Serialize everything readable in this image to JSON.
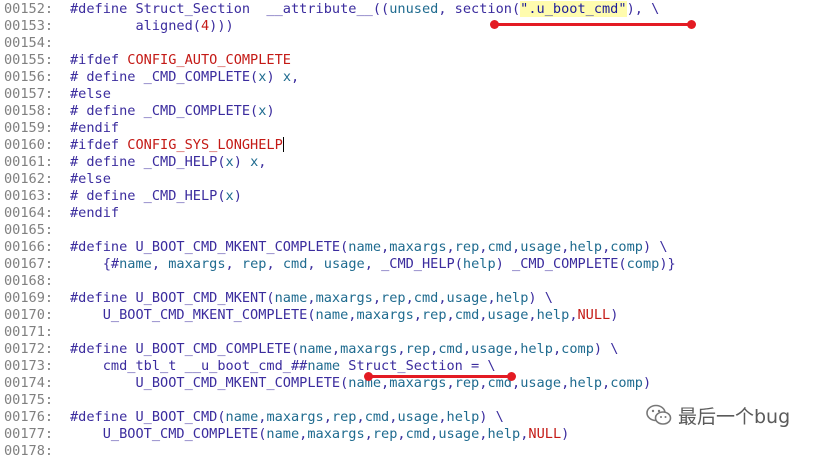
{
  "colors": {
    "line_number": "#808080",
    "keyword": "#3b2c9e",
    "macro": "#c41a16",
    "param": "#1f6b8f",
    "string_highlight": "#fffcae",
    "annotation": "#e31b23"
  },
  "code_lines": [
    {
      "num": "00152:",
      "tokens": [
        {
          "t": "#define",
          "c": "directive"
        },
        {
          "t": " Struct_Section  __attribute__((",
          "c": "ident"
        },
        {
          "t": "unused",
          "c": "param"
        },
        {
          "t": ", section(",
          "c": "ident"
        },
        {
          "t": "\".u_boot_cmd\"",
          "c": "string"
        },
        {
          "t": "), \\",
          "c": "ident"
        }
      ]
    },
    {
      "num": "00153:",
      "tokens": [
        {
          "t": "        aligned(",
          "c": "ident"
        },
        {
          "t": "4",
          "c": "number"
        },
        {
          "t": ")))",
          "c": "ident"
        }
      ]
    },
    {
      "num": "00154:",
      "tokens": []
    },
    {
      "num": "00155:",
      "tokens": [
        {
          "t": "#ifdef",
          "c": "directive"
        },
        {
          "t": " ",
          "c": "ident"
        },
        {
          "t": "CONFIG_AUTO_COMPLETE",
          "c": "macro"
        }
      ]
    },
    {
      "num": "00156:",
      "tokens": [
        {
          "t": "# define _CMD_COMPLETE(",
          "c": "ident"
        },
        {
          "t": "x",
          "c": "param"
        },
        {
          "t": ") ",
          "c": "ident"
        },
        {
          "t": "x",
          "c": "param"
        },
        {
          "t": ",",
          "c": "ident"
        }
      ]
    },
    {
      "num": "00157:",
      "tokens": [
        {
          "t": "#else",
          "c": "directive"
        }
      ]
    },
    {
      "num": "00158:",
      "tokens": [
        {
          "t": "# define _CMD_COMPLETE(",
          "c": "ident"
        },
        {
          "t": "x",
          "c": "param"
        },
        {
          "t": ")",
          "c": "ident"
        }
      ]
    },
    {
      "num": "00159:",
      "tokens": [
        {
          "t": "#endif",
          "c": "directive"
        }
      ]
    },
    {
      "num": "00160:",
      "tokens": [
        {
          "t": "#ifdef",
          "c": "directive"
        },
        {
          "t": " ",
          "c": "ident"
        },
        {
          "t": "CONFIG_SYS_LONGHELP",
          "c": "macro"
        }
      ],
      "cursor": true
    },
    {
      "num": "00161:",
      "tokens": [
        {
          "t": "# define _CMD_HELP(",
          "c": "ident"
        },
        {
          "t": "x",
          "c": "param"
        },
        {
          "t": ") ",
          "c": "ident"
        },
        {
          "t": "x",
          "c": "param"
        },
        {
          "t": ",",
          "c": "ident"
        }
      ]
    },
    {
      "num": "00162:",
      "tokens": [
        {
          "t": "#else",
          "c": "directive"
        }
      ]
    },
    {
      "num": "00163:",
      "tokens": [
        {
          "t": "# define _CMD_HELP(",
          "c": "ident"
        },
        {
          "t": "x",
          "c": "param"
        },
        {
          "t": ")",
          "c": "ident"
        }
      ]
    },
    {
      "num": "00164:",
      "tokens": [
        {
          "t": "#endif",
          "c": "directive"
        }
      ]
    },
    {
      "num": "00165:",
      "tokens": []
    },
    {
      "num": "00166:",
      "tokens": [
        {
          "t": "#define",
          "c": "directive"
        },
        {
          "t": " U_BOOT_CMD_MKENT_COMPLETE(",
          "c": "ident"
        },
        {
          "t": "name",
          "c": "param"
        },
        {
          "t": ",",
          "c": "ident"
        },
        {
          "t": "maxargs",
          "c": "param"
        },
        {
          "t": ",",
          "c": "ident"
        },
        {
          "t": "rep",
          "c": "param"
        },
        {
          "t": ",",
          "c": "ident"
        },
        {
          "t": "cmd",
          "c": "param"
        },
        {
          "t": ",",
          "c": "ident"
        },
        {
          "t": "usage",
          "c": "param"
        },
        {
          "t": ",",
          "c": "ident"
        },
        {
          "t": "help",
          "c": "param"
        },
        {
          "t": ",",
          "c": "ident"
        },
        {
          "t": "comp",
          "c": "param"
        },
        {
          "t": ") \\",
          "c": "ident"
        }
      ]
    },
    {
      "num": "00167:",
      "tokens": [
        {
          "t": "    {#",
          "c": "ident"
        },
        {
          "t": "name",
          "c": "param"
        },
        {
          "t": ", ",
          "c": "ident"
        },
        {
          "t": "maxargs",
          "c": "param"
        },
        {
          "t": ", ",
          "c": "ident"
        },
        {
          "t": "rep",
          "c": "param"
        },
        {
          "t": ", ",
          "c": "ident"
        },
        {
          "t": "cmd",
          "c": "param"
        },
        {
          "t": ", ",
          "c": "ident"
        },
        {
          "t": "usage",
          "c": "param"
        },
        {
          "t": ", _CMD_HELP(",
          "c": "ident"
        },
        {
          "t": "help",
          "c": "param"
        },
        {
          "t": ") _CMD_COMPLETE(",
          "c": "ident"
        },
        {
          "t": "comp",
          "c": "param"
        },
        {
          "t": ")}",
          "c": "ident"
        }
      ]
    },
    {
      "num": "00168:",
      "tokens": []
    },
    {
      "num": "00169:",
      "tokens": [
        {
          "t": "#define",
          "c": "directive"
        },
        {
          "t": " U_BOOT_CMD_MKENT(",
          "c": "ident"
        },
        {
          "t": "name",
          "c": "param"
        },
        {
          "t": ",",
          "c": "ident"
        },
        {
          "t": "maxargs",
          "c": "param"
        },
        {
          "t": ",",
          "c": "ident"
        },
        {
          "t": "rep",
          "c": "param"
        },
        {
          "t": ",",
          "c": "ident"
        },
        {
          "t": "cmd",
          "c": "param"
        },
        {
          "t": ",",
          "c": "ident"
        },
        {
          "t": "usage",
          "c": "param"
        },
        {
          "t": ",",
          "c": "ident"
        },
        {
          "t": "help",
          "c": "param"
        },
        {
          "t": ") \\",
          "c": "ident"
        }
      ]
    },
    {
      "num": "00170:",
      "tokens": [
        {
          "t": "    U_BOOT_CMD_MKENT_COMPLETE(",
          "c": "ident"
        },
        {
          "t": "name",
          "c": "param"
        },
        {
          "t": ",",
          "c": "ident"
        },
        {
          "t": "maxargs",
          "c": "param"
        },
        {
          "t": ",",
          "c": "ident"
        },
        {
          "t": "rep",
          "c": "param"
        },
        {
          "t": ",",
          "c": "ident"
        },
        {
          "t": "cmd",
          "c": "param"
        },
        {
          "t": ",",
          "c": "ident"
        },
        {
          "t": "usage",
          "c": "param"
        },
        {
          "t": ",",
          "c": "ident"
        },
        {
          "t": "help",
          "c": "param"
        },
        {
          "t": ",",
          "c": "ident"
        },
        {
          "t": "NULL",
          "c": "null"
        },
        {
          "t": ")",
          "c": "ident"
        }
      ]
    },
    {
      "num": "00171:",
      "tokens": []
    },
    {
      "num": "00172:",
      "tokens": [
        {
          "t": "#define",
          "c": "directive"
        },
        {
          "t": " U_BOOT_CMD_COMPLETE(",
          "c": "ident"
        },
        {
          "t": "name",
          "c": "param"
        },
        {
          "t": ",",
          "c": "ident"
        },
        {
          "t": "maxargs",
          "c": "param"
        },
        {
          "t": ",",
          "c": "ident"
        },
        {
          "t": "rep",
          "c": "param"
        },
        {
          "t": ",",
          "c": "ident"
        },
        {
          "t": "cmd",
          "c": "param"
        },
        {
          "t": ",",
          "c": "ident"
        },
        {
          "t": "usage",
          "c": "param"
        },
        {
          "t": ",",
          "c": "ident"
        },
        {
          "t": "help",
          "c": "param"
        },
        {
          "t": ",",
          "c": "ident"
        },
        {
          "t": "comp",
          "c": "param"
        },
        {
          "t": ") \\",
          "c": "ident"
        }
      ]
    },
    {
      "num": "00173:",
      "tokens": [
        {
          "t": "    cmd_tbl_t __u_boot_cmd_##",
          "c": "ident"
        },
        {
          "t": "name",
          "c": "param"
        },
        {
          "t": " Struct_Section = \\",
          "c": "ident"
        }
      ]
    },
    {
      "num": "00174:",
      "tokens": [
        {
          "t": "        U_BOOT_CMD_MKENT_COMPLETE(",
          "c": "ident"
        },
        {
          "t": "name",
          "c": "param"
        },
        {
          "t": ",",
          "c": "ident"
        },
        {
          "t": "maxargs",
          "c": "param"
        },
        {
          "t": ",",
          "c": "ident"
        },
        {
          "t": "rep",
          "c": "param"
        },
        {
          "t": ",",
          "c": "ident"
        },
        {
          "t": "cmd",
          "c": "param"
        },
        {
          "t": ",",
          "c": "ident"
        },
        {
          "t": "usage",
          "c": "param"
        },
        {
          "t": ",",
          "c": "ident"
        },
        {
          "t": "help",
          "c": "param"
        },
        {
          "t": ",",
          "c": "ident"
        },
        {
          "t": "comp",
          "c": "param"
        },
        {
          "t": ")",
          "c": "ident"
        }
      ]
    },
    {
      "num": "00175:",
      "tokens": []
    },
    {
      "num": "00176:",
      "tokens": [
        {
          "t": "#define",
          "c": "directive"
        },
        {
          "t": " U_BOOT_CMD(",
          "c": "ident"
        },
        {
          "t": "name",
          "c": "param"
        },
        {
          "t": ",",
          "c": "ident"
        },
        {
          "t": "maxargs",
          "c": "param"
        },
        {
          "t": ",",
          "c": "ident"
        },
        {
          "t": "rep",
          "c": "param"
        },
        {
          "t": ",",
          "c": "ident"
        },
        {
          "t": "cmd",
          "c": "param"
        },
        {
          "t": ",",
          "c": "ident"
        },
        {
          "t": "usage",
          "c": "param"
        },
        {
          "t": ",",
          "c": "ident"
        },
        {
          "t": "help",
          "c": "param"
        },
        {
          "t": ") \\",
          "c": "ident"
        }
      ]
    },
    {
      "num": "00177:",
      "tokens": [
        {
          "t": "    U_BOOT_CMD_COMPLETE(",
          "c": "ident"
        },
        {
          "t": "name",
          "c": "param"
        },
        {
          "t": ",",
          "c": "ident"
        },
        {
          "t": "maxargs",
          "c": "param"
        },
        {
          "t": ",",
          "c": "ident"
        },
        {
          "t": "rep",
          "c": "param"
        },
        {
          "t": ",",
          "c": "ident"
        },
        {
          "t": "cmd",
          "c": "param"
        },
        {
          "t": ",",
          "c": "ident"
        },
        {
          "t": "usage",
          "c": "param"
        },
        {
          "t": ",",
          "c": "ident"
        },
        {
          "t": "help",
          "c": "param"
        },
        {
          "t": ",",
          "c": "ident"
        },
        {
          "t": "NULL",
          "c": "null"
        },
        {
          "t": ")",
          "c": "ident"
        }
      ]
    },
    {
      "num": "00178:",
      "tokens": []
    }
  ],
  "watermark": {
    "icon": "wechat-icon",
    "text": "最后一个bug"
  }
}
